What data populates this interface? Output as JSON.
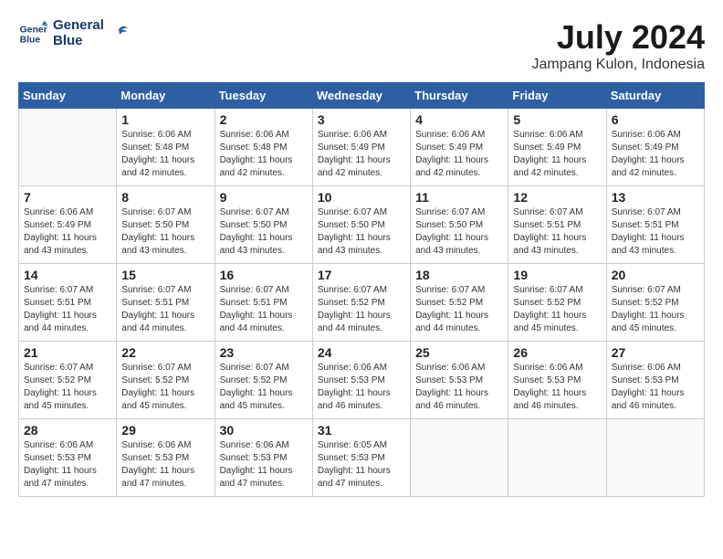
{
  "header": {
    "logo_line1": "General",
    "logo_line2": "Blue",
    "month_year": "July 2024",
    "location": "Jampang Kulon, Indonesia"
  },
  "weekdays": [
    "Sunday",
    "Monday",
    "Tuesday",
    "Wednesday",
    "Thursday",
    "Friday",
    "Saturday"
  ],
  "weeks": [
    [
      {
        "day": "",
        "sunrise": "",
        "sunset": "",
        "daylight": "",
        "minutes": ""
      },
      {
        "day": "1",
        "sunrise": "Sunrise: 6:06 AM",
        "sunset": "Sunset: 5:48 PM",
        "daylight": "Daylight: 11 hours",
        "minutes": "and 42 minutes."
      },
      {
        "day": "2",
        "sunrise": "Sunrise: 6:06 AM",
        "sunset": "Sunset: 5:48 PM",
        "daylight": "Daylight: 11 hours",
        "minutes": "and 42 minutes."
      },
      {
        "day": "3",
        "sunrise": "Sunrise: 6:06 AM",
        "sunset": "Sunset: 5:49 PM",
        "daylight": "Daylight: 11 hours",
        "minutes": "and 42 minutes."
      },
      {
        "day": "4",
        "sunrise": "Sunrise: 6:06 AM",
        "sunset": "Sunset: 5:49 PM",
        "daylight": "Daylight: 11 hours",
        "minutes": "and 42 minutes."
      },
      {
        "day": "5",
        "sunrise": "Sunrise: 6:06 AM",
        "sunset": "Sunset: 5:49 PM",
        "daylight": "Daylight: 11 hours",
        "minutes": "and 42 minutes."
      },
      {
        "day": "6",
        "sunrise": "Sunrise: 6:06 AM",
        "sunset": "Sunset: 5:49 PM",
        "daylight": "Daylight: 11 hours",
        "minutes": "and 42 minutes."
      }
    ],
    [
      {
        "day": "7",
        "sunrise": "Sunrise: 6:06 AM",
        "sunset": "Sunset: 5:49 PM",
        "daylight": "Daylight: 11 hours",
        "minutes": "and 43 minutes."
      },
      {
        "day": "8",
        "sunrise": "Sunrise: 6:07 AM",
        "sunset": "Sunset: 5:50 PM",
        "daylight": "Daylight: 11 hours",
        "minutes": "and 43 minutes."
      },
      {
        "day": "9",
        "sunrise": "Sunrise: 6:07 AM",
        "sunset": "Sunset: 5:50 PM",
        "daylight": "Daylight: 11 hours",
        "minutes": "and 43 minutes."
      },
      {
        "day": "10",
        "sunrise": "Sunrise: 6:07 AM",
        "sunset": "Sunset: 5:50 PM",
        "daylight": "Daylight: 11 hours",
        "minutes": "and 43 minutes."
      },
      {
        "day": "11",
        "sunrise": "Sunrise: 6:07 AM",
        "sunset": "Sunset: 5:50 PM",
        "daylight": "Daylight: 11 hours",
        "minutes": "and 43 minutes."
      },
      {
        "day": "12",
        "sunrise": "Sunrise: 6:07 AM",
        "sunset": "Sunset: 5:51 PM",
        "daylight": "Daylight: 11 hours",
        "minutes": "and 43 minutes."
      },
      {
        "day": "13",
        "sunrise": "Sunrise: 6:07 AM",
        "sunset": "Sunset: 5:51 PM",
        "daylight": "Daylight: 11 hours",
        "minutes": "and 43 minutes."
      }
    ],
    [
      {
        "day": "14",
        "sunrise": "Sunrise: 6:07 AM",
        "sunset": "Sunset: 5:51 PM",
        "daylight": "Daylight: 11 hours",
        "minutes": "and 44 minutes."
      },
      {
        "day": "15",
        "sunrise": "Sunrise: 6:07 AM",
        "sunset": "Sunset: 5:51 PM",
        "daylight": "Daylight: 11 hours",
        "minutes": "and 44 minutes."
      },
      {
        "day": "16",
        "sunrise": "Sunrise: 6:07 AM",
        "sunset": "Sunset: 5:51 PM",
        "daylight": "Daylight: 11 hours",
        "minutes": "and 44 minutes."
      },
      {
        "day": "17",
        "sunrise": "Sunrise: 6:07 AM",
        "sunset": "Sunset: 5:52 PM",
        "daylight": "Daylight: 11 hours",
        "minutes": "and 44 minutes."
      },
      {
        "day": "18",
        "sunrise": "Sunrise: 6:07 AM",
        "sunset": "Sunset: 5:52 PM",
        "daylight": "Daylight: 11 hours",
        "minutes": "and 44 minutes."
      },
      {
        "day": "19",
        "sunrise": "Sunrise: 6:07 AM",
        "sunset": "Sunset: 5:52 PM",
        "daylight": "Daylight: 11 hours",
        "minutes": "and 45 minutes."
      },
      {
        "day": "20",
        "sunrise": "Sunrise: 6:07 AM",
        "sunset": "Sunset: 5:52 PM",
        "daylight": "Daylight: 11 hours",
        "minutes": "and 45 minutes."
      }
    ],
    [
      {
        "day": "21",
        "sunrise": "Sunrise: 6:07 AM",
        "sunset": "Sunset: 5:52 PM",
        "daylight": "Daylight: 11 hours",
        "minutes": "and 45 minutes."
      },
      {
        "day": "22",
        "sunrise": "Sunrise: 6:07 AM",
        "sunset": "Sunset: 5:52 PM",
        "daylight": "Daylight: 11 hours",
        "minutes": "and 45 minutes."
      },
      {
        "day": "23",
        "sunrise": "Sunrise: 6:07 AM",
        "sunset": "Sunset: 5:52 PM",
        "daylight": "Daylight: 11 hours",
        "minutes": "and 45 minutes."
      },
      {
        "day": "24",
        "sunrise": "Sunrise: 6:06 AM",
        "sunset": "Sunset: 5:53 PM",
        "daylight": "Daylight: 11 hours",
        "minutes": "and 46 minutes."
      },
      {
        "day": "25",
        "sunrise": "Sunrise: 6:06 AM",
        "sunset": "Sunset: 5:53 PM",
        "daylight": "Daylight: 11 hours",
        "minutes": "and 46 minutes."
      },
      {
        "day": "26",
        "sunrise": "Sunrise: 6:06 AM",
        "sunset": "Sunset: 5:53 PM",
        "daylight": "Daylight: 11 hours",
        "minutes": "and 46 minutes."
      },
      {
        "day": "27",
        "sunrise": "Sunrise: 6:06 AM",
        "sunset": "Sunset: 5:53 PM",
        "daylight": "Daylight: 11 hours",
        "minutes": "and 46 minutes."
      }
    ],
    [
      {
        "day": "28",
        "sunrise": "Sunrise: 6:06 AM",
        "sunset": "Sunset: 5:53 PM",
        "daylight": "Daylight: 11 hours",
        "minutes": "and 47 minutes."
      },
      {
        "day": "29",
        "sunrise": "Sunrise: 6:06 AM",
        "sunset": "Sunset: 5:53 PM",
        "daylight": "Daylight: 11 hours",
        "minutes": "and 47 minutes."
      },
      {
        "day": "30",
        "sunrise": "Sunrise: 6:06 AM",
        "sunset": "Sunset: 5:53 PM",
        "daylight": "Daylight: 11 hours",
        "minutes": "and 47 minutes."
      },
      {
        "day": "31",
        "sunrise": "Sunrise: 6:05 AM",
        "sunset": "Sunset: 5:53 PM",
        "daylight": "Daylight: 11 hours",
        "minutes": "and 47 minutes."
      },
      {
        "day": "",
        "sunrise": "",
        "sunset": "",
        "daylight": "",
        "minutes": ""
      },
      {
        "day": "",
        "sunrise": "",
        "sunset": "",
        "daylight": "",
        "minutes": ""
      },
      {
        "day": "",
        "sunrise": "",
        "sunset": "",
        "daylight": "",
        "minutes": ""
      }
    ]
  ]
}
